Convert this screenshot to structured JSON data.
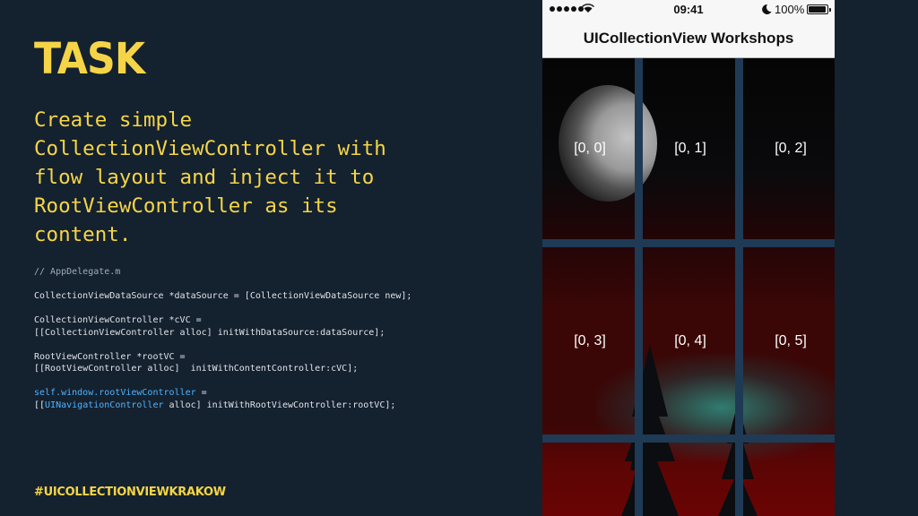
{
  "slide": {
    "title": "TASK",
    "description": "Create simple\nCollectionViewController with\nflow layout and inject it to\nRootViewController as its\ncontent.",
    "code": [
      {
        "parts": [
          {
            "t": "// AppDelegate.m",
            "c": "comment"
          }
        ]
      },
      {
        "parts": [
          {
            "t": "",
            "c": ""
          }
        ]
      },
      {
        "parts": [
          {
            "t": "CollectionViewDataSource *dataSource = [CollectionViewDataSource new];",
            "c": ""
          }
        ]
      },
      {
        "parts": [
          {
            "t": "",
            "c": ""
          }
        ]
      },
      {
        "parts": [
          {
            "t": "CollectionViewController *cVC =",
            "c": ""
          }
        ]
      },
      {
        "parts": [
          {
            "t": "[[CollectionViewController alloc] initWithDataSource:dataSource];",
            "c": ""
          }
        ]
      },
      {
        "parts": [
          {
            "t": "",
            "c": ""
          }
        ]
      },
      {
        "parts": [
          {
            "t": "RootViewController *rootVC =",
            "c": ""
          }
        ]
      },
      {
        "parts": [
          {
            "t": "[[RootViewController alloc]  initWithContentController:cVC];",
            "c": ""
          }
        ]
      },
      {
        "parts": [
          {
            "t": "",
            "c": ""
          }
        ]
      },
      {
        "parts": [
          {
            "t": "self.window.rootViewController",
            "c": "kw"
          },
          {
            "t": " =",
            "c": ""
          }
        ]
      },
      {
        "parts": [
          {
            "t": "[[",
            "c": ""
          },
          {
            "t": "UINavigationController",
            "c": "kw"
          },
          {
            "t": " alloc] initWithRootViewController:rootVC];",
            "c": ""
          }
        ]
      }
    ],
    "hashtag": "#UICOLLECTIONVIEWKRAKOW"
  },
  "phone": {
    "status_bar": {
      "time": "09:41",
      "battery": "100%",
      "icons": [
        "signal-dots-icon",
        "wifi-icon",
        "moon-icon",
        "battery-icon"
      ]
    },
    "nav_title": "UICollectionView Workshops",
    "cells": [
      "[0, 0]",
      "[0, 1]",
      "[0, 2]",
      "[0, 3]",
      "[0, 4]",
      "[0, 5]"
    ]
  },
  "colors": {
    "background": "#14212f",
    "accent": "#f5d547",
    "code_text": "#dfe3e8",
    "code_keyword": "#4fb3ff"
  }
}
